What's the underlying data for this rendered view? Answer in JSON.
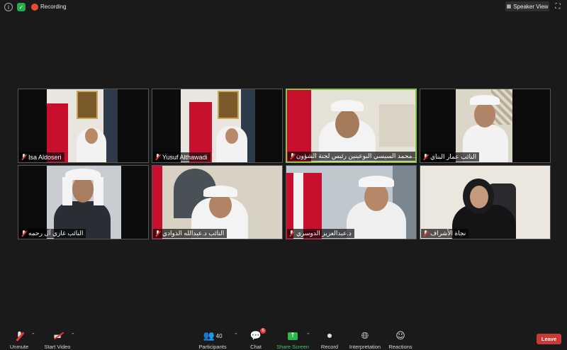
{
  "top_bar": {
    "recording_label": "Recording",
    "speaker_view_label": "Speaker View"
  },
  "participants": [
    {
      "name": "Isa Aldoseri"
    },
    {
      "name": "Yusuf Althawadi"
    },
    {
      "name": "محمد السيسي البوعينين رئيس لجنة الشؤون..."
    },
    {
      "name": "النائب عمار البناي"
    },
    {
      "name": "النائب غازي آل رحمه"
    },
    {
      "name": "النائب د.عبدالله الذوادي"
    },
    {
      "name": "د.عبدالعزيز الدوسري"
    },
    {
      "name": "نجاة الأشراف"
    }
  ],
  "toolbar": {
    "unmute_label": "Unmute",
    "start_video_label": "Start Video",
    "participants_label": "Participants",
    "participants_count": "40",
    "chat_label": "Chat",
    "chat_badge": "6",
    "share_screen_label": "Share Screen",
    "record_label": "Record",
    "interpretation_label": "Interpretation",
    "reactions_label": "Reactions",
    "leave_label": "Leave"
  },
  "colors": {
    "active_speaker_border": "#8bc34a",
    "share_green": "#2eb84b",
    "leave_red": "#c93a36",
    "recording_red": "#e84b2f"
  }
}
